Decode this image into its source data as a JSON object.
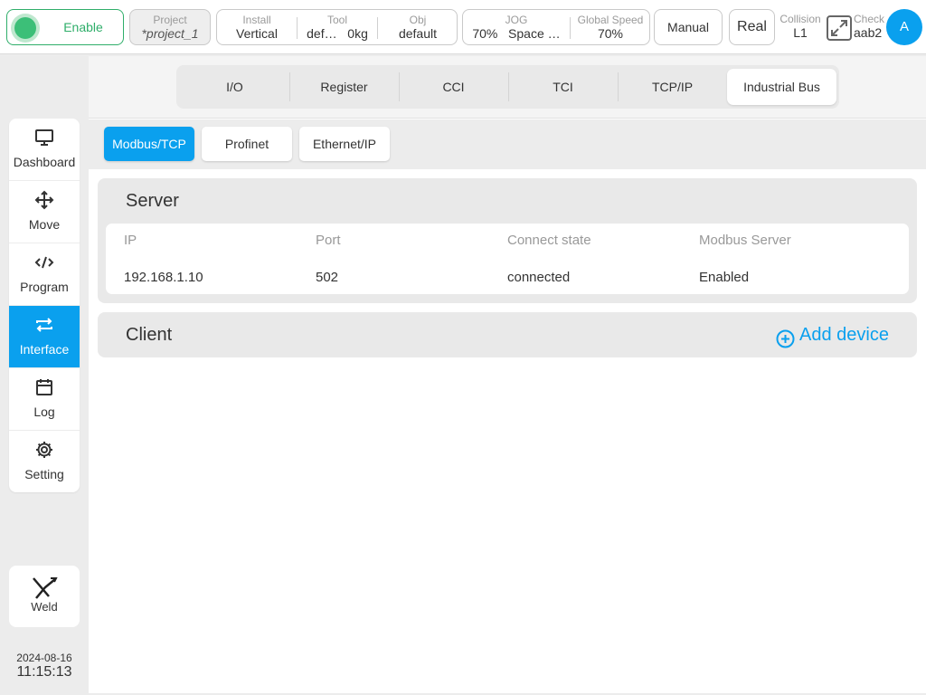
{
  "colors": {
    "accent": "#0aa0ee",
    "enabled_green": "#2fae6a"
  },
  "topbar": {
    "enable_label": "Enable",
    "project": {
      "label": "Project",
      "value": "*project_1"
    },
    "install": {
      "label": "Install",
      "value": "Vertical"
    },
    "tool": {
      "label": "Tool",
      "value_name": "def…",
      "value_load": "0kg"
    },
    "obj": {
      "label": "Obj",
      "value": "default"
    },
    "jog": {
      "label": "JOG",
      "value_percent": "70%",
      "value_mode": "Space …"
    },
    "global_speed": {
      "label": "Global Speed",
      "value": "70%"
    },
    "manual_label": "Manual",
    "real_label": "Real",
    "collision": {
      "label": "Collision",
      "value": "L1"
    },
    "check": {
      "label": "Check",
      "value": "aab2"
    },
    "avatar_letter": "A"
  },
  "sidebar": {
    "items": [
      {
        "label": "Dashboard",
        "icon": "monitor-icon"
      },
      {
        "label": "Move",
        "icon": "move-arrows-icon"
      },
      {
        "label": "Program",
        "icon": "code-icon"
      },
      {
        "label": "Interface",
        "icon": "swap-arrows-icon",
        "active": true
      },
      {
        "label": "Log",
        "icon": "calendar-icon"
      },
      {
        "label": "Setting",
        "icon": "gear-icon"
      }
    ],
    "weld_label": "Weld",
    "date": "2024-08-16",
    "time": "11:15:13"
  },
  "main": {
    "tabs": [
      "I/O",
      "Register",
      "CCI",
      "TCI",
      "TCP/IP",
      "Industrial Bus"
    ],
    "active_tab": "Industrial Bus",
    "subtabs": [
      "Modbus/TCP",
      "Profinet",
      "Ethernet/IP"
    ],
    "active_subtab": "Modbus/TCP",
    "server": {
      "title": "Server",
      "columns": [
        "IP",
        "Port",
        "Connect state",
        "Modbus Server"
      ],
      "row": [
        "192.168.1.10",
        "502",
        "connected",
        "Enabled"
      ]
    },
    "client": {
      "title": "Client",
      "add_device_label": "Add device"
    }
  }
}
